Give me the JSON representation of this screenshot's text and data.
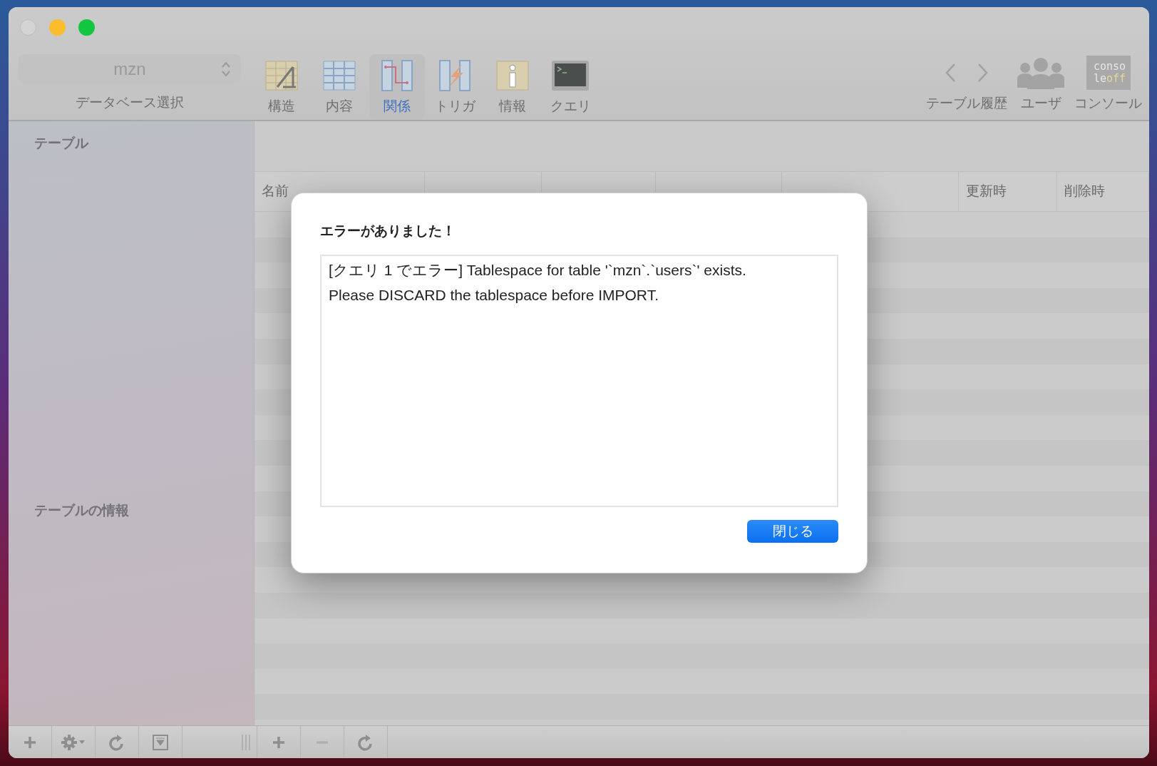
{
  "toolbar": {
    "database_select": {
      "value": "mzn",
      "label": "データベース選択"
    },
    "tabs": [
      {
        "label": "構造",
        "kind": "structure",
        "selected": false
      },
      {
        "label": "内容",
        "kind": "content",
        "selected": false
      },
      {
        "label": "関係",
        "kind": "relations",
        "selected": true
      },
      {
        "label": "トリガ",
        "kind": "triggers",
        "selected": false
      },
      {
        "label": "情報",
        "kind": "info",
        "selected": false
      },
      {
        "label": "クエリ",
        "kind": "query",
        "selected": false
      }
    ],
    "history": {
      "label": "テーブル履歴"
    },
    "users": {
      "label": "ユーザ"
    },
    "console": {
      "label": "コンソール",
      "icon_text": [
        "conso",
        "le",
        "off"
      ]
    }
  },
  "sidebar": {
    "tables_heading": "テーブル",
    "info_heading": "テーブルの情報"
  },
  "table": {
    "columns": [
      "名前",
      "更新時",
      "削除時"
    ]
  },
  "dialog": {
    "title": "エラーがありました！",
    "message": "[クエリ 1 でエラー] Tablespace for table '`mzn`.`users`' exists.\nPlease DISCARD the tablespace before IMPORT.",
    "buttons": [
      "閉じる"
    ]
  }
}
